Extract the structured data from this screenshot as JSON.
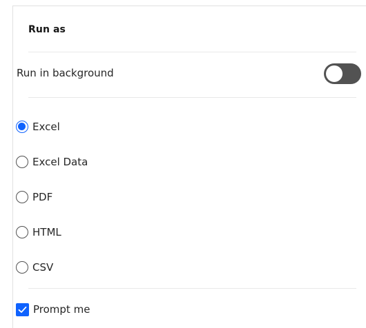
{
  "panel": {
    "title": "Run as"
  },
  "background": {
    "label": "Run in background",
    "enabled": false
  },
  "formats": [
    {
      "label": "Excel",
      "selected": true
    },
    {
      "label": "Excel Data",
      "selected": false
    },
    {
      "label": "PDF",
      "selected": false
    },
    {
      "label": "HTML",
      "selected": false
    },
    {
      "label": "CSV",
      "selected": false
    }
  ],
  "prompt": {
    "label": "Prompt me",
    "checked": true
  },
  "colors": {
    "accent": "#0f62fe",
    "toggle_off": "#525252"
  },
  "icons": {
    "checkbox": "checkmark-icon"
  }
}
